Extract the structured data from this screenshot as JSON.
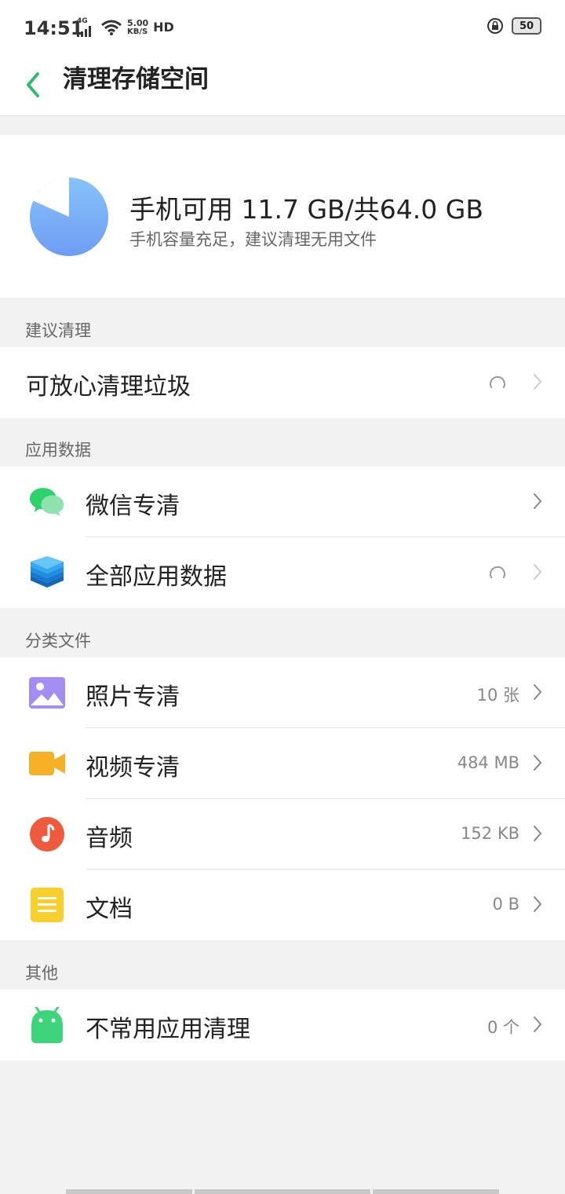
{
  "status": {
    "time": "14:51",
    "network": "4G",
    "speed_value": "5.00",
    "speed_unit": "KB/S",
    "hd": "HD",
    "battery": "50"
  },
  "header": {
    "title": "清理存储空间",
    "back_icon": "chevron-left-icon"
  },
  "storage": {
    "summary": "手机可用 11.7 GB/共64.0 GB",
    "hint": "手机容量充足，建议清理无用文件",
    "available_fraction": 0.183,
    "pie_color": "#7fb6f7"
  },
  "sections": {
    "suggest": {
      "label": "建议清理",
      "items": [
        {
          "label": "可放心清理垃圾",
          "status": "loading"
        }
      ]
    },
    "app_data": {
      "label": "应用数据",
      "items": [
        {
          "label": "微信专清",
          "icon": "wechat-icon"
        },
        {
          "label": "全部应用数据",
          "icon": "layers-icon",
          "status": "loading"
        }
      ]
    },
    "files": {
      "label": "分类文件",
      "items": [
        {
          "label": "照片专清",
          "value": "10 张",
          "icon": "photo-icon"
        },
        {
          "label": "视频专清",
          "value": "484 MB",
          "icon": "video-icon"
        },
        {
          "label": "音频",
          "value": "152 KB",
          "icon": "music-icon"
        },
        {
          "label": "文档",
          "value": "0 B",
          "icon": "document-icon"
        }
      ]
    },
    "other": {
      "label": "其他",
      "items": [
        {
          "label": "不常用应用清理",
          "value": "0 个",
          "icon": "android-icon"
        }
      ]
    }
  },
  "colors": {
    "accent": "#2dbb6e",
    "wechat": "#2fd16a",
    "layers": "#1e8fe0",
    "photo": "#a38cf2",
    "video": "#f6b026",
    "music": "#ee5a3c",
    "document": "#f8cf2c",
    "android": "#3ed47c"
  }
}
